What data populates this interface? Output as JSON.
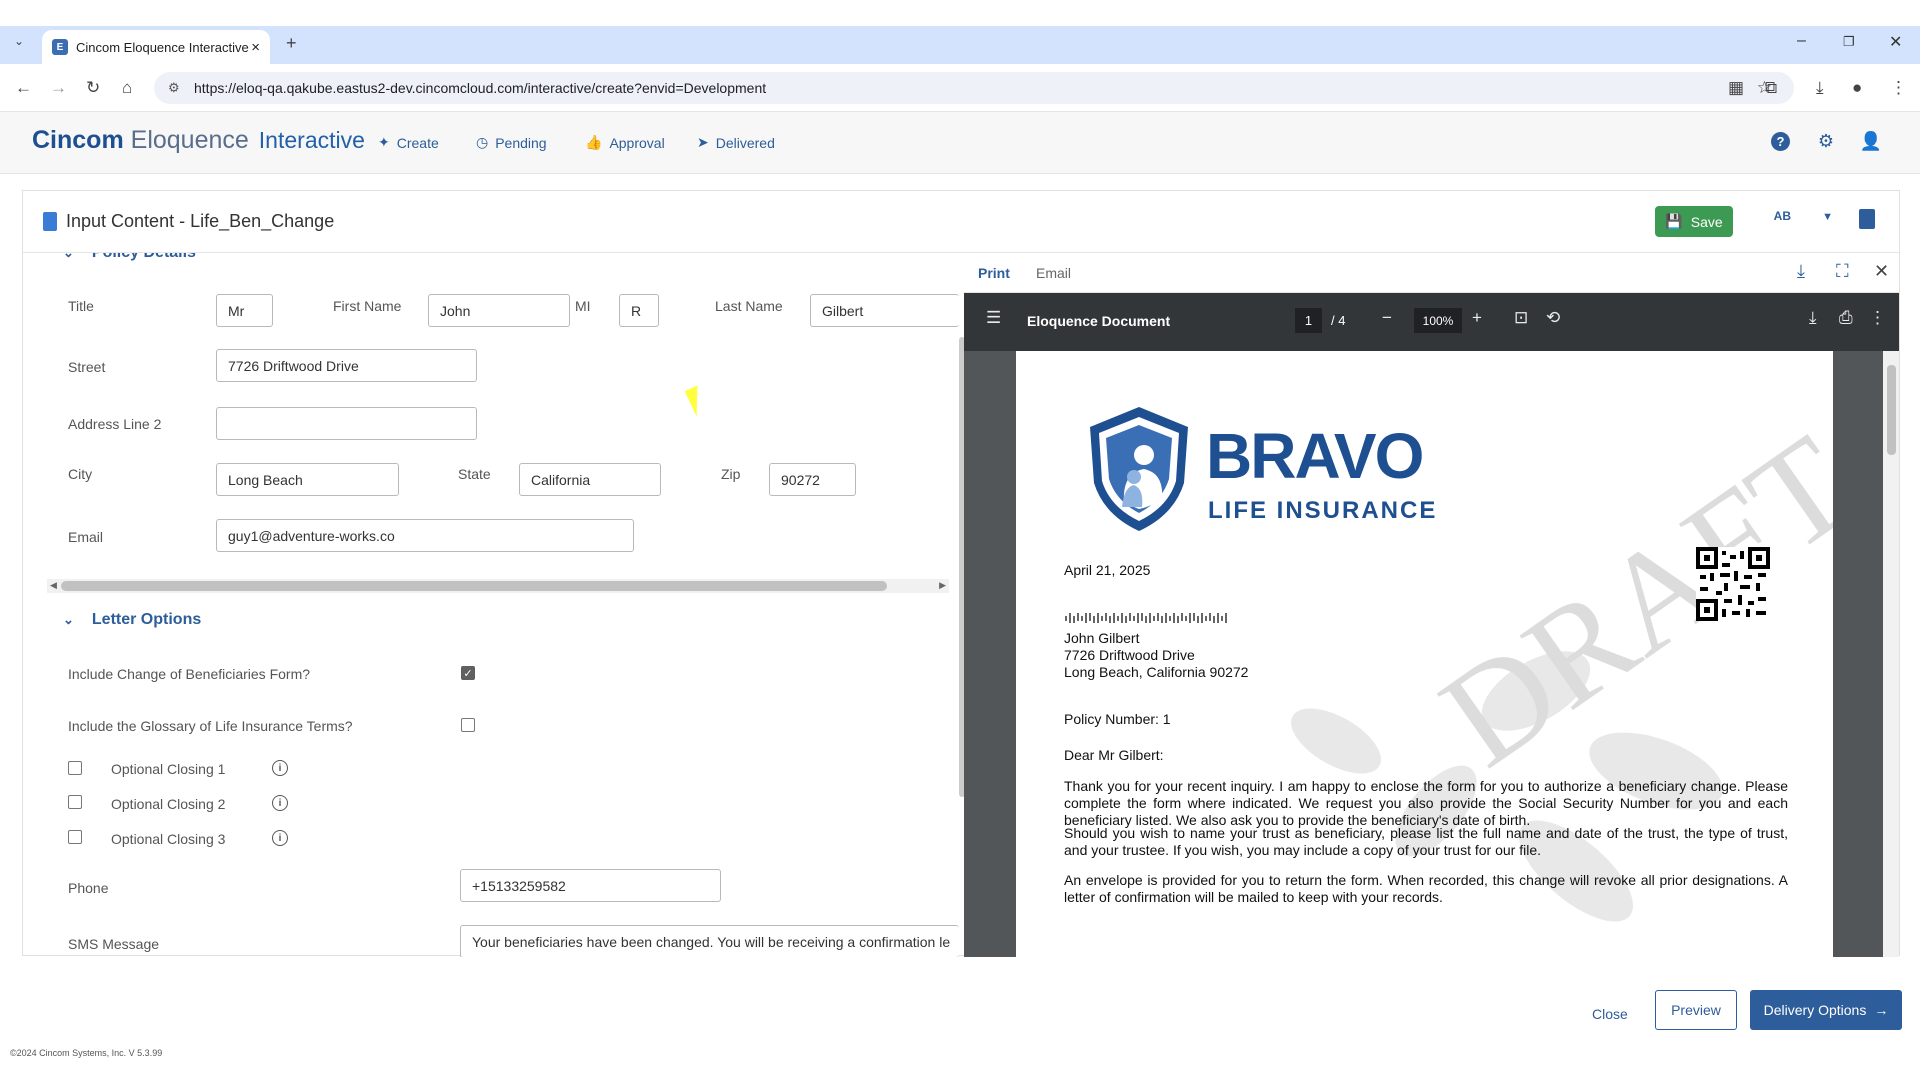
{
  "browser": {
    "tab_title": "Cincom Eloquence Interactive",
    "url": "https://eloq-qa.qakube.eastus2-dev.cincomcloud.com/interactive/create?envid=Development"
  },
  "app": {
    "brand_cincom": "Cincom",
    "brand_eloquence": "Eloquence",
    "brand_interactive": "Interactive",
    "nav": [
      {
        "label": "Create",
        "icon": "sparkle-icon"
      },
      {
        "label": "Pending",
        "icon": "clock-icon"
      },
      {
        "label": "Approval",
        "icon": "thumbs-up-icon"
      },
      {
        "label": "Delivered",
        "icon": "send-icon"
      }
    ]
  },
  "card": {
    "title": "Input Content - Life_Ben_Change",
    "save_label": "Save",
    "spell_label": "AB"
  },
  "form": {
    "policy_section": "Policy Details",
    "labels": {
      "title": "Title",
      "first_name": "First Name",
      "mi": "MI",
      "last_name": "Last Name",
      "street": "Street",
      "address2": "Address Line 2",
      "city": "City",
      "state": "State",
      "zip": "Zip",
      "email": "Email",
      "phone": "Phone",
      "sms": "SMS Message"
    },
    "values": {
      "title": "Mr",
      "first_name": "John",
      "mi": "R",
      "last_name": "Gilbert",
      "street": "7726 Driftwood Drive",
      "address2": "",
      "city": "Long Beach",
      "state": "California",
      "zip": "90272",
      "email": "guy1@adventure-works.co",
      "phone": "+15133259582",
      "sms": "Your beneficiaries have been changed. You will be receiving a confirmation le"
    },
    "letter_section": "Letter Options",
    "options": {
      "change_form_label": "Include Change of Beneficiaries Form?",
      "change_form_checked": true,
      "glossary_label": "Include the Glossary of Life Insurance Terms?",
      "glossary_checked": false,
      "closing1": "Optional Closing 1",
      "closing2": "Optional Closing 2",
      "closing3": "Optional Closing 3"
    }
  },
  "preview": {
    "tab_print": "Print",
    "tab_email": "Email",
    "doc_title": "Eloquence Document",
    "page_current": "1",
    "page_total": "/ 4",
    "zoom": "100%",
    "letter": {
      "logo_main": "BRAVO",
      "logo_sub": "LIFE INSURANCE",
      "watermark": "DRAFT",
      "date": "April 21, 2025",
      "addr_name": "John Gilbert",
      "addr_street": "7726 Driftwood Drive",
      "addr_city": "Long Beach, California 90272",
      "policy": "Policy Number: 1",
      "salutation": "Dear Mr Gilbert:",
      "p1": "Thank you for your recent inquiry. I am happy to enclose the form for you to authorize a beneficiary change. Please complete the form where indicated.  We request you also provide the Social Security Number for you and each beneficiary listed. We also ask you to provide the beneficiary's date of birth.",
      "p2": "Should you wish to name your trust as beneficiary, please list the full name and date of the trust, the type of trust, and your trustee.  If you wish, you may include a copy of your trust for our file.",
      "p3": "An envelope is provided for you to return the form.  When recorded, this change will revoke all prior designations. A letter of confirmation will be mailed to keep with your records."
    }
  },
  "footer": {
    "close": "Close",
    "preview": "Preview",
    "delivery": "Delivery Options",
    "copyright": "©2024 Cincom Systems, Inc. V 5.3.99"
  }
}
